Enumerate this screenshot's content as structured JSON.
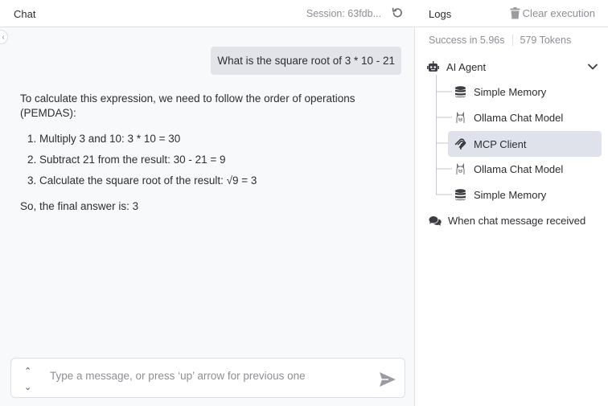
{
  "chat": {
    "title": "Chat",
    "session": "Session: 63fdb...",
    "user_message": "What is the square root of 3 * 10 - 21",
    "bot_intro": "To calculate this expression, we need to follow the order of operations (PEMDAS):",
    "bot_steps": [
      "Multiply 3 and 10: 3 * 10 = 30",
      "Subtract 21 from the result: 30 - 21 = 9",
      "Calculate the square root of the result: √9 = 3"
    ],
    "bot_conclusion": "So, the final answer is: 3",
    "input_placeholder": "Type a message, or press ‘up’ arrow for previous one"
  },
  "logs": {
    "title": "Logs",
    "clear_label": "Clear execution",
    "status": "Success in 5.96s",
    "tokens": "579 Tokens",
    "root": {
      "label": "AI Agent",
      "icon": "robot-icon"
    },
    "children": [
      {
        "label": "Simple Memory",
        "icon": "database-icon",
        "selected": false
      },
      {
        "label": "Ollama Chat Model",
        "icon": "ollama-icon",
        "selected": false
      },
      {
        "label": "MCP Client",
        "icon": "mcp-icon",
        "selected": true
      },
      {
        "label": "Ollama Chat Model",
        "icon": "ollama-icon",
        "selected": false
      },
      {
        "label": "Simple Memory",
        "icon": "database-icon",
        "selected": false
      }
    ],
    "trigger": {
      "label": "When chat message received",
      "icon": "comments-icon"
    }
  },
  "colors": {
    "selected_bg": "#dfe2ea",
    "user_bubble": "#e2e4e9",
    "muted_text": "#8d8f95"
  }
}
